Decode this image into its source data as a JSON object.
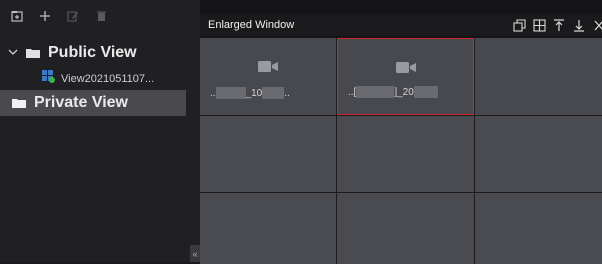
{
  "sidebar": {
    "toolbar": [
      {
        "icon": "add-folder-icon"
      },
      {
        "icon": "plus-icon"
      },
      {
        "icon": "edit-icon"
      },
      {
        "icon": "delete-icon"
      }
    ],
    "public_group": {
      "label": "Public View",
      "expanded": true
    },
    "view_item": {
      "label": "View2021051107..."
    },
    "private_group": {
      "label": "Private View",
      "selected": true
    },
    "collapse_glyph": "«"
  },
  "main": {
    "title": "Enlarged Window",
    "header_icons": [
      "restore-window-icon",
      "grid-layout-icon",
      "pin-top-icon",
      "download-icon",
      "close-icon"
    ],
    "cells": [
      {
        "label_prefix": "..",
        "label_suffix": "_10",
        "label_tail": "..",
        "has_camera": true,
        "selected": false
      },
      {
        "label_prefix": "..[",
        "label_suffix": "]_20",
        "label_tail": "",
        "has_camera": true,
        "selected": true
      },
      {
        "has_camera": false,
        "selected": false
      },
      {
        "has_camera": false,
        "selected": false
      },
      {
        "has_camera": false,
        "selected": false
      },
      {
        "has_camera": false,
        "selected": false
      },
      {
        "has_camera": false,
        "selected": false
      },
      {
        "has_camera": false,
        "selected": false
      },
      {
        "has_camera": false,
        "selected": false
      }
    ]
  },
  "colors": {
    "selection_border": "#d0262c",
    "cell_bg": "#4a4b50",
    "selected_row_bg": "#4a4a4e"
  }
}
